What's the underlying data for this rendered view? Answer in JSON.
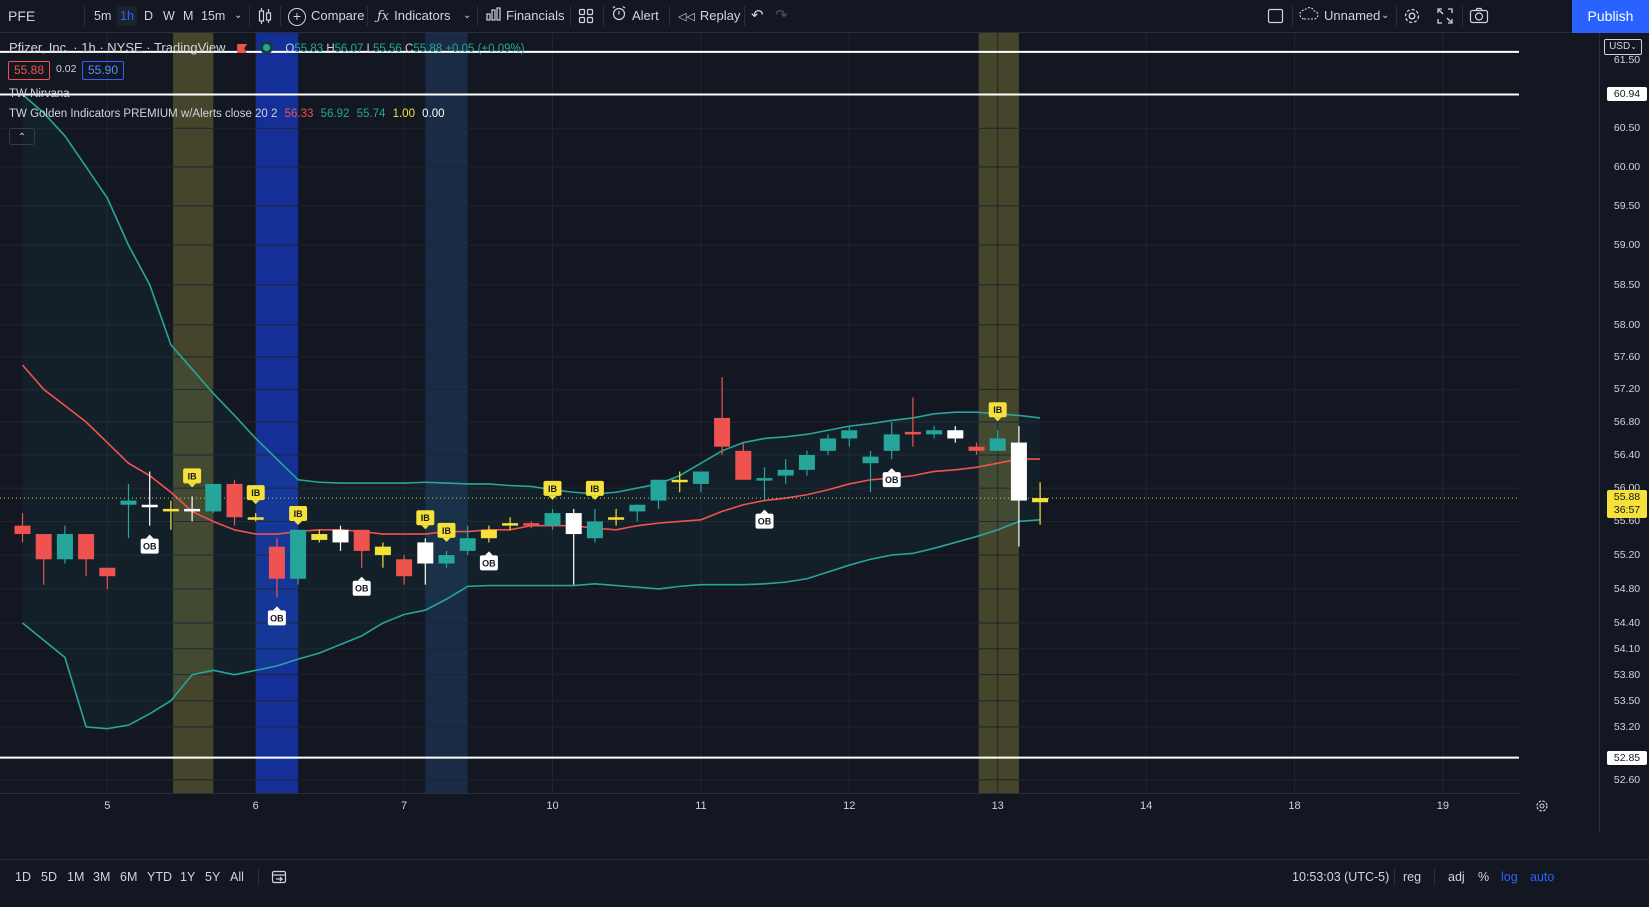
{
  "toolbar": {
    "symbol": "PFE",
    "intervals": [
      "5m",
      "1h",
      "D",
      "W",
      "M",
      "15m"
    ],
    "active_interval": "1h",
    "compare": "Compare",
    "indicators": "Indicators",
    "financials": "Financials",
    "alert": "Alert",
    "replay": "Replay",
    "layout_name": "Unnamed",
    "publish": "Publish"
  },
  "legend": {
    "title": "Pfizer, Inc. · 1h · NYSE · TradingView",
    "open_label": "O",
    "open": "55.83",
    "high_label": "H",
    "high": "56.07",
    "low_label": "L",
    "low": "55.56",
    "close_label": "C",
    "close": "55.88",
    "change": "+0.05 (+0.09%)",
    "bid": "55.88",
    "spread": "0.02",
    "ask": "55.90",
    "indicator1": "TW Nirvana",
    "indicator2_name": "TW Golden Indicators PREMIUM w/Alerts close 20 2",
    "ind_v1": "56.33",
    "ind_v2": "56.92",
    "ind_v3": "55.74",
    "ind_v4": "1.00",
    "ind_v5": "0.00"
  },
  "price_axis": {
    "currency": "USD",
    "labels": [
      "61.50",
      "60.94",
      "60.50",
      "60.00",
      "59.50",
      "59.00",
      "58.50",
      "58.00",
      "57.60",
      "57.20",
      "56.80",
      "56.40",
      "56.00",
      "55.60",
      "55.20",
      "54.80",
      "54.40",
      "54.10",
      "53.80",
      "53.50",
      "53.20",
      "52.85",
      "52.60"
    ],
    "current_price": "55.88",
    "countdown": "36:57"
  },
  "time_axis": {
    "labels": [
      "5",
      "6",
      "7",
      "10",
      "11",
      "12",
      "13",
      "14",
      "18",
      "19"
    ]
  },
  "bottom": {
    "ranges": [
      "1D",
      "5D",
      "1M",
      "3M",
      "6M",
      "YTD",
      "1Y",
      "5Y",
      "All"
    ],
    "clock": "10:53:03 (UTC-5)",
    "session": "reg",
    "adj": "adj",
    "percent": "%",
    "log": "log",
    "auto": "auto"
  },
  "colors": {
    "background": "#131722",
    "up": "#26a69a",
    "down": "#ef5350",
    "basis": "#ef5350",
    "bands": "#26a69a",
    "accent": "#2962ff",
    "ib_marker": "#f5e13a"
  },
  "chart_data": {
    "type": "candlestick",
    "candles": [
      {
        "o": 55.55,
        "h": 55.7,
        "l": 55.35,
        "c": 55.45
      },
      {
        "o": 55.15,
        "h": 55.3,
        "l": 54.85,
        "c": 55.45
      },
      {
        "o": 55.45,
        "h": 55.55,
        "l": 55.1,
        "c": 55.15
      },
      {
        "o": 55.15,
        "h": 55.45,
        "l": 54.95,
        "c": 55.45
      },
      {
        "o": 55.05,
        "h": 55.05,
        "l": 54.8,
        "c": 54.95
      },
      {
        "o": 55.8,
        "h": 56.05,
        "l": 55.4,
        "c": 55.85
      },
      {
        "o": 55.8,
        "h": 56.2,
        "l": 55.55,
        "c": 55.78
      },
      {
        "o": 55.75,
        "h": 55.85,
        "l": 55.5,
        "c": 55.75
      },
      {
        "o": 55.75,
        "h": 55.9,
        "l": 55.6,
        "c": 55.75
      },
      {
        "o": 55.72,
        "h": 56.0,
        "l": 55.7,
        "c": 56.05
      },
      {
        "o": 56.05,
        "h": 56.1,
        "l": 55.55,
        "c": 55.65
      },
      {
        "o": 55.65,
        "h": 55.7,
        "l": 55.6,
        "c": 55.62
      },
      {
        "o": 54.92,
        "h": 55.4,
        "l": 54.7,
        "c": 55.3
      },
      {
        "o": 54.92,
        "h": 55.45,
        "l": 54.85,
        "c": 55.5
      },
      {
        "o": 55.45,
        "h": 55.5,
        "l": 55.35,
        "c": 55.38
      },
      {
        "o": 55.35,
        "h": 55.55,
        "l": 55.25,
        "c": 55.5
      },
      {
        "o": 55.5,
        "h": 55.5,
        "l": 55.05,
        "c": 55.25
      },
      {
        "o": 55.2,
        "h": 55.35,
        "l": 55.05,
        "c": 55.3
      },
      {
        "o": 55.15,
        "h": 55.2,
        "l": 54.85,
        "c": 54.95
      },
      {
        "o": 55.1,
        "h": 55.4,
        "l": 54.85,
        "c": 55.35
      },
      {
        "o": 55.1,
        "h": 55.25,
        "l": 55.05,
        "c": 55.2
      },
      {
        "o": 55.25,
        "h": 55.55,
        "l": 55.2,
        "c": 55.4
      },
      {
        "o": 55.4,
        "h": 55.55,
        "l": 55.35,
        "c": 55.5
      },
      {
        "o": 55.55,
        "h": 55.65,
        "l": 55.5,
        "c": 55.58
      },
      {
        "o": 55.58,
        "h": 55.6,
        "l": 55.52,
        "c": 55.55
      },
      {
        "o": 55.55,
        "h": 55.75,
        "l": 55.5,
        "c": 55.7
      },
      {
        "o": 55.45,
        "h": 55.75,
        "l": 54.85,
        "c": 55.7
      },
      {
        "o": 55.4,
        "h": 55.75,
        "l": 55.35,
        "c": 55.6
      },
      {
        "o": 55.62,
        "h": 55.75,
        "l": 55.55,
        "c": 55.65
      },
      {
        "o": 55.72,
        "h": 55.8,
        "l": 55.6,
        "c": 55.8
      },
      {
        "o": 55.85,
        "h": 56.1,
        "l": 55.75,
        "c": 56.1
      },
      {
        "o": 56.1,
        "h": 56.2,
        "l": 55.95,
        "c": 56.08
      },
      {
        "o": 56.05,
        "h": 56.2,
        "l": 55.95,
        "c": 56.2
      },
      {
        "o": 56.85,
        "h": 57.35,
        "l": 56.4,
        "c": 56.5
      },
      {
        "o": 56.45,
        "h": 56.55,
        "l": 56.1,
        "c": 56.1
      },
      {
        "o": 56.1,
        "h": 56.25,
        "l": 55.85,
        "c": 56.12
      },
      {
        "o": 56.15,
        "h": 56.35,
        "l": 56.05,
        "c": 56.22
      },
      {
        "o": 56.22,
        "h": 56.45,
        "l": 56.15,
        "c": 56.4
      },
      {
        "o": 56.45,
        "h": 56.65,
        "l": 56.4,
        "c": 56.6
      },
      {
        "o": 56.6,
        "h": 56.75,
        "l": 56.5,
        "c": 56.7
      },
      {
        "o": 56.38,
        "h": 56.45,
        "l": 55.95,
        "c": 56.3
      },
      {
        "o": 56.45,
        "h": 56.8,
        "l": 56.35,
        "c": 56.65
      },
      {
        "o": 56.65,
        "h": 57.1,
        "l": 56.5,
        "c": 56.68
      },
      {
        "o": 56.65,
        "h": 56.75,
        "l": 56.6,
        "c": 56.7
      },
      {
        "o": 56.7,
        "h": 56.75,
        "l": 56.55,
        "c": 56.6
      },
      {
        "o": 56.5,
        "h": 56.55,
        "l": 56.4,
        "c": 56.45
      },
      {
        "o": 56.45,
        "h": 56.7,
        "l": 56.45,
        "c": 56.6
      },
      {
        "o": 56.55,
        "h": 56.75,
        "l": 55.3,
        "c": 55.85
      },
      {
        "o": 55.83,
        "h": 56.07,
        "l": 55.56,
        "c": 55.88
      }
    ],
    "candle_colors": [
      "down",
      "down",
      "up",
      "down",
      "down",
      "up",
      "white",
      "yellow",
      "white",
      "up",
      "down",
      "yellow",
      "down",
      "up",
      "yellow",
      "white",
      "down",
      "yellow",
      "down",
      "white",
      "up",
      "up",
      "yellow",
      "yellow",
      "down",
      "up",
      "white",
      "up",
      "yellow",
      "up",
      "up",
      "yellow",
      "up",
      "down",
      "down",
      "up",
      "up",
      "up",
      "up",
      "up",
      "up",
      "up",
      "down",
      "up",
      "white",
      "down",
      "up",
      "white",
      "yellow"
    ],
    "basis": [
      57.5,
      57.2,
      57.0,
      56.8,
      56.55,
      56.3,
      56.15,
      55.95,
      55.72,
      55.6,
      55.5,
      55.45,
      55.45,
      55.48,
      55.5,
      55.5,
      55.48,
      55.45,
      55.45,
      55.45,
      55.48,
      55.48,
      55.5,
      55.5,
      55.55,
      55.55,
      55.55,
      55.52,
      55.5,
      55.55,
      55.58,
      55.6,
      55.62,
      55.72,
      55.8,
      55.85,
      55.88,
      55.92,
      55.98,
      56.05,
      56.1,
      56.12,
      56.15,
      56.2,
      56.22,
      56.25,
      56.3,
      56.35,
      56.35
    ],
    "upper_band": [
      60.94,
      60.7,
      60.4,
      60.0,
      59.6,
      59.0,
      58.5,
      57.75,
      57.45,
      57.15,
      56.88,
      56.6,
      56.35,
      56.1,
      56.07,
      56.06,
      56.06,
      56.06,
      56.06,
      56.07,
      56.06,
      56.05,
      56.05,
      56.03,
      56.02,
      55.98,
      55.95,
      55.93,
      55.95,
      56.0,
      56.05,
      56.15,
      56.3,
      56.45,
      56.55,
      56.6,
      56.62,
      56.65,
      56.7,
      56.75,
      56.78,
      56.82,
      56.85,
      56.9,
      56.92,
      56.92,
      56.9,
      56.88,
      56.85
    ],
    "lower_band": [
      54.4,
      54.2,
      54.0,
      53.2,
      53.18,
      53.22,
      53.35,
      53.5,
      53.8,
      53.85,
      53.8,
      53.85,
      53.9,
      53.98,
      54.05,
      54.15,
      54.25,
      54.4,
      54.5,
      54.55,
      54.68,
      54.83,
      54.84,
      54.84,
      54.84,
      54.84,
      54.84,
      54.86,
      54.84,
      54.82,
      54.8,
      54.83,
      54.85,
      54.85,
      54.85,
      54.86,
      54.88,
      54.92,
      55.0,
      55.08,
      55.15,
      55.2,
      55.22,
      55.28,
      55.35,
      55.42,
      55.5,
      55.6,
      55.62
    ],
    "horizontal_levels": [
      61.5,
      60.94,
      52.85
    ],
    "last_price": 55.88,
    "y_range": [
      52.45,
      61.75
    ],
    "ib_markers": [
      8,
      11,
      13,
      19,
      20,
      25,
      27,
      46
    ],
    "ob_markers": [
      6,
      12,
      16,
      22,
      35,
      41
    ],
    "highlight_zones": [
      {
        "from": 7.6,
        "to": 9.5,
        "color": "#4a4a2c"
      },
      {
        "from": 11.5,
        "to": 13.5,
        "color": "#1533a5"
      },
      {
        "from": 19.5,
        "to": 21.5,
        "color": "#1c2e49"
      },
      {
        "from": 45.6,
        "to": 47.5,
        "color": "#4a4a2c"
      }
    ],
    "x_ticks": [
      {
        "idx": 4,
        "label": "5"
      },
      {
        "idx": 11,
        "label": "6"
      },
      {
        "idx": 18,
        "label": "7"
      },
      {
        "idx": 25,
        "label": "10"
      },
      {
        "idx": 32,
        "label": "11"
      },
      {
        "idx": 39,
        "label": "12"
      },
      {
        "idx": 46,
        "label": "13"
      },
      {
        "idx": 53,
        "label": "14"
      },
      {
        "idx": 60,
        "label": "18"
      },
      {
        "idx": 67,
        "label": "19"
      }
    ]
  }
}
